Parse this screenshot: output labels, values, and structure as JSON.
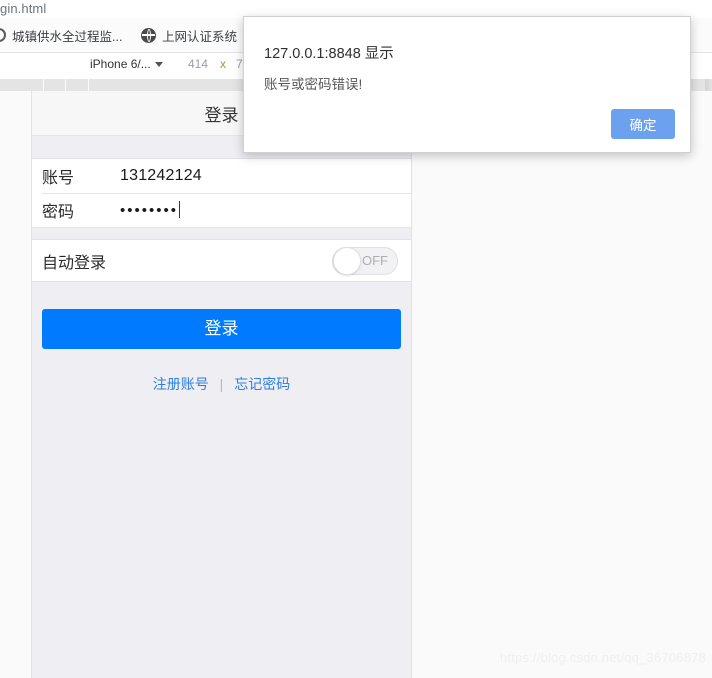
{
  "browser": {
    "tab_title": "gin.html",
    "bookmarks": [
      {
        "label": "城镇供水全过程监...",
        "icon": "circle-favicon"
      },
      {
        "label": "上网认证系统",
        "icon": "globe-favicon"
      }
    ]
  },
  "devtools": {
    "device_name": "iPhone 6/...",
    "width": "414",
    "separator": "x",
    "height": "7"
  },
  "page": {
    "header_title": "登录",
    "fields": [
      {
        "label": "账号",
        "value": "131242124"
      },
      {
        "label": "密码",
        "value": "••••••••"
      }
    ],
    "auto_login": {
      "label": "自动登录",
      "state": "OFF"
    },
    "login_button": "登录",
    "links": [
      {
        "label": "注册账号"
      },
      {
        "label": "忘记密码"
      }
    ],
    "link_separator": "|"
  },
  "dialog": {
    "origin": "127.0.0.1:8848 显示",
    "message": "账号或密码错误!",
    "ok_label": "确定",
    "accent_color": "#6ba1ee"
  },
  "watermark": "https://blog.csdn.net/qq_36706878",
  "colors": {
    "primary_button": "#007bff",
    "link": "#2f7fe0",
    "page_bg": "#eeeef3"
  }
}
